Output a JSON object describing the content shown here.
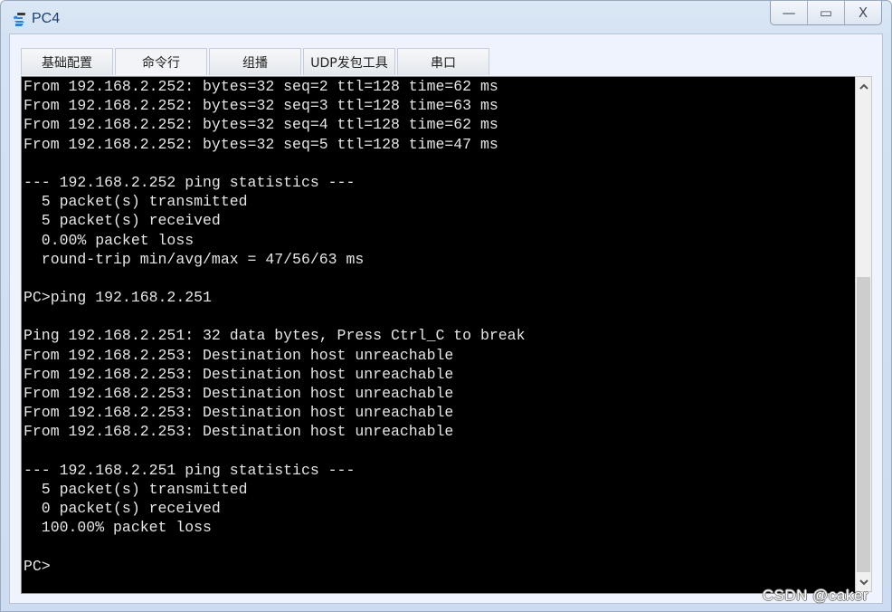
{
  "window": {
    "title": "PC4",
    "icon": "network-pc-icon",
    "controls": {
      "minimize": "—",
      "maximize": "▭",
      "close": "X"
    }
  },
  "tabs": [
    {
      "label": "基础配置",
      "active": false
    },
    {
      "label": "命令行",
      "active": true
    },
    {
      "label": "组播",
      "active": false
    },
    {
      "label": "UDP发包工具",
      "active": false
    },
    {
      "label": "串口",
      "active": false
    }
  ],
  "terminal": {
    "lines": [
      "From 192.168.2.252: bytes=32 seq=2 ttl=128 time=62 ms",
      "From 192.168.2.252: bytes=32 seq=3 ttl=128 time=63 ms",
      "From 192.168.2.252: bytes=32 seq=4 ttl=128 time=62 ms",
      "From 192.168.2.252: bytes=32 seq=5 ttl=128 time=47 ms",
      "",
      "--- 192.168.2.252 ping statistics ---",
      "  5 packet(s) transmitted",
      "  5 packet(s) received",
      "  0.00% packet loss",
      "  round-trip min/avg/max = 47/56/63 ms",
      "",
      "PC>ping 192.168.2.251",
      "",
      "Ping 192.168.2.251: 32 data bytes, Press Ctrl_C to break",
      "From 192.168.2.253: Destination host unreachable",
      "From 192.168.2.253: Destination host unreachable",
      "From 192.168.2.253: Destination host unreachable",
      "From 192.168.2.253: Destination host unreachable",
      "From 192.168.2.253: Destination host unreachable",
      "",
      "--- 192.168.2.251 ping statistics ---",
      "  5 packet(s) transmitted",
      "  0 packet(s) received",
      "  100.00% packet loss",
      "",
      "PC>"
    ]
  },
  "scrollbar": {
    "up_arrow": "^",
    "down_arrow": "v"
  },
  "watermark": "CSDN @caker"
}
